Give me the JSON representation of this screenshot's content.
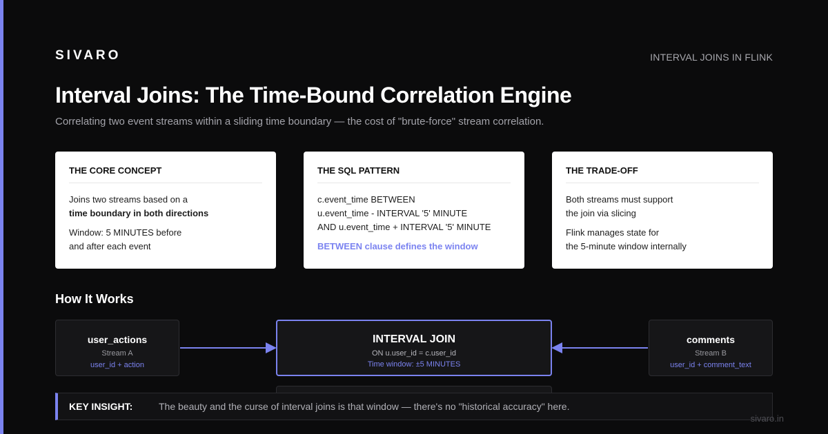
{
  "brand": "SIVARO",
  "topic": "INTERVAL JOINS IN FLINK",
  "title": "Interval Joins: The Time-Bound Correlation Engine",
  "subtitle": "Correlating two event streams within a sliding time boundary — the cost of \"brute-force\" stream correlation.",
  "cards": [
    {
      "heading": "THE CORE CONCEPT",
      "line1": "Joins two streams based on a",
      "line2": "time boundary in both directions",
      "line3": "Window: 5 MINUTES before",
      "line4": "and after each event"
    },
    {
      "heading": "THE SQL PATTERN",
      "line1": "c.event_time BETWEEN",
      "line2": "u.event_time - INTERVAL '5' MINUTE",
      "line3": "AND u.event_time + INTERVAL '5' MINUTE",
      "line4": "BETWEEN clause defines the window"
    },
    {
      "heading": "THE TRADE-OFF",
      "line1": "Both streams must support",
      "line2": "the join via slicing",
      "line3": "Flink manages state for",
      "line4": "the 5-minute window internally"
    }
  ],
  "how_it_works": {
    "title": "How It Works",
    "stream_a": {
      "name": "user_actions",
      "label": "Stream A",
      "fields": "user_id + action"
    },
    "join": {
      "name": "INTERVAL JOIN",
      "condition": "ON u.user_id = c.user_id",
      "window": "Time window: ±5 MINUTES"
    },
    "stream_b": {
      "name": "comments",
      "label": "Stream B",
      "fields": "user_id + comment_text"
    }
  },
  "insight": {
    "label": "KEY INSIGHT:",
    "text": "The beauty and the curse of interval joins is that window — there's no \"historical accuracy\" here."
  },
  "footer_url": "sivaro.in",
  "colors": {
    "accent": "#7b83f0",
    "background": "#0b0b0c",
    "card": "#ffffff"
  }
}
